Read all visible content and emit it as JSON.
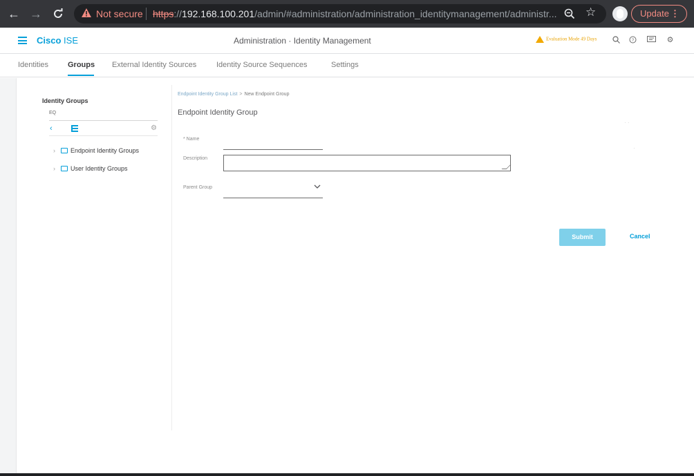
{
  "browser": {
    "not_secure": "Not secure",
    "url_proto": "https",
    "url_sep": "://",
    "url_host": "192.168.100.201",
    "url_path": "/admin/#administration/administration_identitymanagement/administr...",
    "update_label": "Update"
  },
  "app": {
    "brand_bold": "Cisco",
    "brand_light": "ISE",
    "page_title": "Administration · Identity Management",
    "evaluation": "Evaluation Mode 49 Days"
  },
  "tabs": [
    {
      "label": "Identities"
    },
    {
      "label": "Groups"
    },
    {
      "label": "External Identity Sources"
    },
    {
      "label": "Identity Source Sequences"
    },
    {
      "label": "Settings"
    }
  ],
  "sidebar": {
    "title": "Identity Groups",
    "search_text": "EQ",
    "items": [
      {
        "label": "Endpoint Identity Groups"
      },
      {
        "label": "User Identity Groups"
      }
    ]
  },
  "form": {
    "breadcrumb_parent": "Endpoint Identity Group List",
    "breadcrumb_current": "New Endpoint Group",
    "title": "Endpoint Identity Group",
    "name_label": "* Name",
    "name_value": "",
    "description_label": "Description",
    "description_value": "",
    "parent_group_label": "Parent Group",
    "parent_group_value": "",
    "submit_label": "Submit",
    "cancel_label": "Cancel"
  },
  "colors": {
    "accent": "#049fd9",
    "submit_bg": "#7fd0ea",
    "warning": "#f2a900",
    "not_secure": "#f28b82"
  }
}
